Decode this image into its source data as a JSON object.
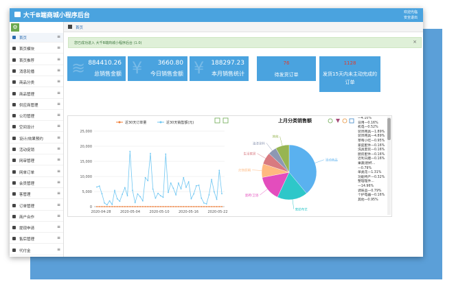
{
  "app": {
    "title": "大千B端商城小程序后台",
    "user_line1": "欢迎光临",
    "user_line2": "安全退出"
  },
  "sidebar": {
    "items": [
      {
        "label": "首页",
        "active": true
      },
      {
        "label": "首页模块"
      },
      {
        "label": "首页推荐"
      },
      {
        "label": "消息轮播"
      },
      {
        "label": "商品分类"
      },
      {
        "label": "商品管理"
      },
      {
        "label": "供应商管理"
      },
      {
        "label": "公司管理"
      },
      {
        "label": "空间设计"
      },
      {
        "label": "设计/效果预约"
      },
      {
        "label": "活动促销"
      },
      {
        "label": "网审管理"
      },
      {
        "label": "网单订单"
      },
      {
        "label": "会员管理"
      },
      {
        "label": "客管理"
      },
      {
        "label": "订单管理"
      },
      {
        "label": "商户合作"
      },
      {
        "label": "提现申请"
      },
      {
        "label": "售后管理"
      },
      {
        "label": "代付金"
      }
    ]
  },
  "breadcrumb": {
    "label": "首页"
  },
  "alert": {
    "text": "您已成功进入 大千B端商城小程序后台 (1.0)",
    "close": "×"
  },
  "cards": [
    {
      "value": "884410.26",
      "label": "总销售金额",
      "icon": "database-icon"
    },
    {
      "value": "3660.80",
      "label": "今日销售金额",
      "icon": "yen-icon"
    },
    {
      "value": "188297.23",
      "label": "本月销售统计",
      "icon": "yen-icon"
    },
    {
      "value": "76",
      "label": "待发货订单",
      "icon": ""
    },
    {
      "value": "1128",
      "label": "发货15天内未主动完成的订单",
      "icon": ""
    }
  ],
  "colors": {
    "primary": "#4aa3df",
    "line_order": "#f07b32",
    "line_sales": "#6ec6f2"
  },
  "chart_data": [
    {
      "type": "line",
      "title": "",
      "series": [
        {
          "name": "近30天订单量",
          "values": [
            0,
            0,
            0,
            0,
            0,
            0,
            0,
            0,
            0,
            0,
            0,
            0,
            0,
            0,
            0,
            0,
            0,
            0,
            0,
            0,
            0,
            0,
            0,
            0,
            0,
            0,
            0,
            0,
            0,
            0,
            0,
            0,
            0,
            0,
            0,
            0,
            0,
            0,
            0,
            0,
            0,
            0,
            0,
            0,
            0,
            0,
            0,
            0,
            0,
            0
          ]
        },
        {
          "name": "近30天销售额(元)",
          "values": [
            6500,
            6800,
            4300,
            1200,
            600,
            1900,
            700,
            5400,
            2600,
            1800,
            4100,
            6300,
            3600,
            18300,
            5400,
            1300,
            4200,
            3300,
            1900,
            9600,
            8600,
            17600,
            5800,
            2800,
            4400,
            3600,
            3100,
            17400,
            4700,
            7800,
            6100,
            3900,
            7800,
            5900,
            9600,
            6400,
            8200,
            2600,
            4200,
            6900,
            7100,
            2800,
            1200,
            900,
            3900,
            9000,
            4900,
            2400,
            12000,
            4300
          ]
        }
      ],
      "x_ticks": [
        "2020-04-28",
        "2020-05-04",
        "2020-05-10",
        "2020-05-16",
        "2020-05-22"
      ],
      "ylim": [
        0,
        25000
      ],
      "y_ticks": [
        "0",
        "5,000",
        "10,000",
        "15,000",
        "20,000",
        "25,000"
      ],
      "grid": true,
      "legend": "top"
    },
    {
      "type": "pie",
      "title": "上月分类销售额",
      "slices": [
        {
          "label": "活动商品",
          "value": 39,
          "color": "#5ab1ef"
        },
        {
          "label": "家纺布艺",
          "value": 18,
          "color": "#2ec7c9"
        },
        {
          "label": "瓷砖/卫浴",
          "value": 15,
          "color": "#e34dbd"
        },
        {
          "label": "灯饰照明",
          "value": 8,
          "color": "#ffb980"
        },
        {
          "label": "生活家居",
          "value": 7,
          "color": "#d87a80"
        },
        {
          "label": "油漆涂料",
          "value": 5,
          "color": "#8d98b3"
        },
        {
          "label": "其他",
          "value": 8,
          "color": "#97b552"
        }
      ],
      "right_list": [
        "—4.10%",
        "日用—0.16%",
        "机电—0.52%",
        "装饰用具—1.89%",
        "装饰用具—4.89%",
        "草莓小吃—0.95%",
        "家庭配件—0.16%",
        "洗具套装—0.16%",
        "厨房配件—0.16%",
        "近利日磨—0.16%",
        "果蔬/厨杯...",
        "—0.79%",
        "单类花—1.31%",
        "功能特产—0.32%",
        "整理理件...",
        "—14.96%",
        "调味品—0.79%",
        "个护电器—0.16%",
        "其他—0.95%"
      ]
    }
  ]
}
